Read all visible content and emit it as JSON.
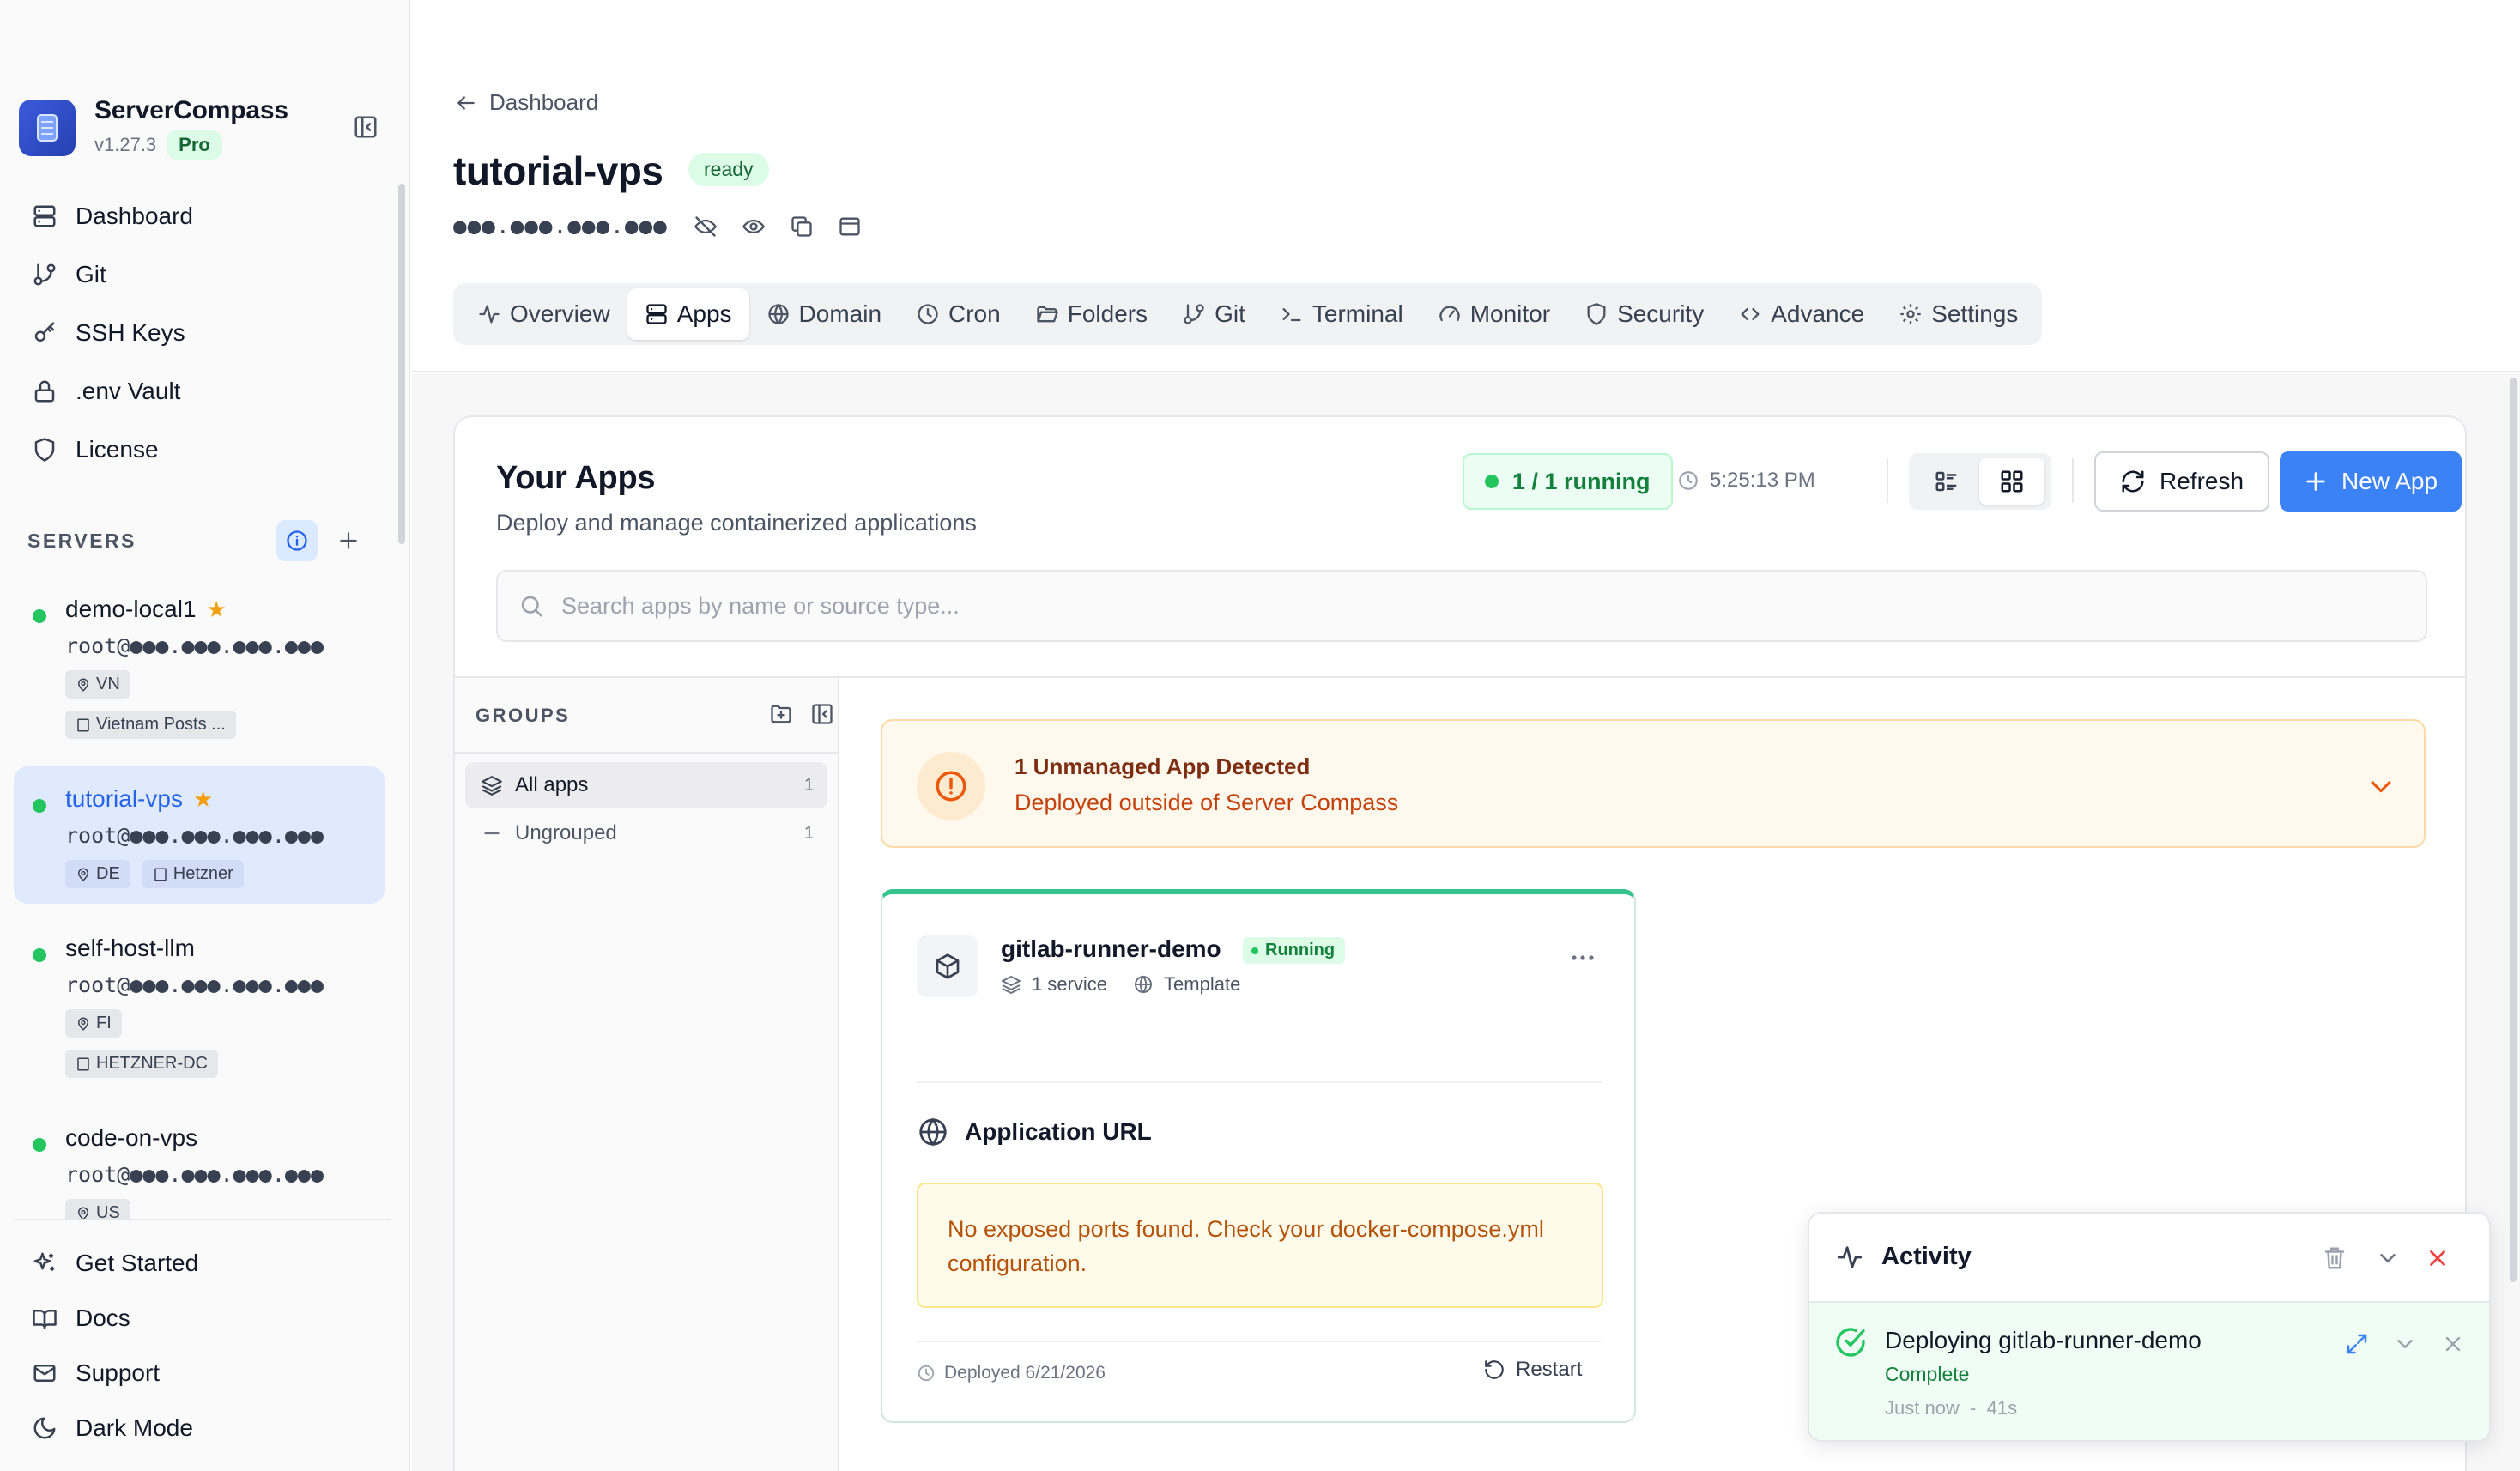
{
  "sidebar": {
    "brand": {
      "name": "ServerCompass",
      "version": "v1.27.3",
      "badge": "Pro"
    },
    "nav": [
      {
        "label": "Dashboard",
        "icon": "dashboard-icon"
      },
      {
        "label": "Git",
        "icon": "git-branch-icon"
      },
      {
        "label": "SSH Keys",
        "icon": "key-icon"
      },
      {
        "label": ".env Vault",
        "icon": "lock-icon"
      },
      {
        "label": "License",
        "icon": "shield-icon"
      }
    ],
    "servers_title": "SERVERS",
    "servers": [
      {
        "name": "demo-local1",
        "host": "root@●●●.●●●.●●●.●●●",
        "location": "VN",
        "provider": "Vietnam Posts ...",
        "favorite": true,
        "active": false
      },
      {
        "name": "tutorial-vps",
        "host": "root@●●●.●●●.●●●.●●●",
        "location": "DE",
        "provider": "Hetzner",
        "favorite": true,
        "active": true
      },
      {
        "name": "self-host-llm",
        "host": "root@●●●.●●●.●●●.●●●",
        "location": "FI",
        "provider": "HETZNER-DC",
        "favorite": false,
        "active": false
      },
      {
        "name": "code-on-vps",
        "host": "root@●●●.●●●.●●●.●●●",
        "location": "US",
        "provider": "",
        "favorite": false,
        "active": false
      }
    ],
    "bottom": [
      {
        "label": "Get Started",
        "icon": "sparkles-icon"
      },
      {
        "label": "Docs",
        "icon": "book-icon"
      },
      {
        "label": "Support",
        "icon": "mail-icon"
      },
      {
        "label": "Dark Mode",
        "icon": "moon-icon"
      }
    ]
  },
  "header": {
    "breadcrumb": "Dashboard",
    "title": "tutorial-vps",
    "status": "ready",
    "ip": "●●●.●●●.●●●.●●●"
  },
  "tabs": [
    {
      "label": "Overview",
      "active": false
    },
    {
      "label": "Apps",
      "active": true
    },
    {
      "label": "Domain",
      "active": false
    },
    {
      "label": "Cron",
      "active": false
    },
    {
      "label": "Folders",
      "active": false
    },
    {
      "label": "Git",
      "active": false
    },
    {
      "label": "Terminal",
      "active": false
    },
    {
      "label": "Monitor",
      "active": false
    },
    {
      "label": "Security",
      "active": false
    },
    {
      "label": "Advance",
      "active": false
    },
    {
      "label": "Settings",
      "active": false
    }
  ],
  "apps": {
    "title": "Your Apps",
    "subtitle": "Deploy and manage containerized applications",
    "running": "1 / 1 running",
    "time": "5:25:13 PM",
    "refresh_label": "Refresh",
    "new_app_label": "New App",
    "search_placeholder": "Search apps by name or source type...",
    "search_value": ""
  },
  "groups": {
    "title": "GROUPS",
    "items": [
      {
        "label": "All apps",
        "count": "1"
      },
      {
        "label": "Ungrouped",
        "count": "1"
      }
    ]
  },
  "alert": {
    "title": "1 Unmanaged App Detected",
    "subtitle": "Deployed outside of Server Compass"
  },
  "app_card": {
    "name": "gitlab-runner-demo",
    "status": "Running",
    "services": "1 service",
    "source": "Template",
    "url_heading": "Application URL",
    "warning": "No exposed ports found. Check your docker-compose.yml configuration.",
    "deployed": "Deployed 6/21/2026",
    "restart_label": "Restart"
  },
  "activity": {
    "title": "Activity",
    "item": {
      "title": "Deploying gitlab-runner-demo",
      "status": "Complete",
      "time": "Just now  -  41s"
    }
  },
  "colors": {
    "accent": "#3b82f6",
    "success": "#22c55e",
    "warning": "#c2410c",
    "danger": "#ef4444",
    "star": "#f59e0b"
  }
}
